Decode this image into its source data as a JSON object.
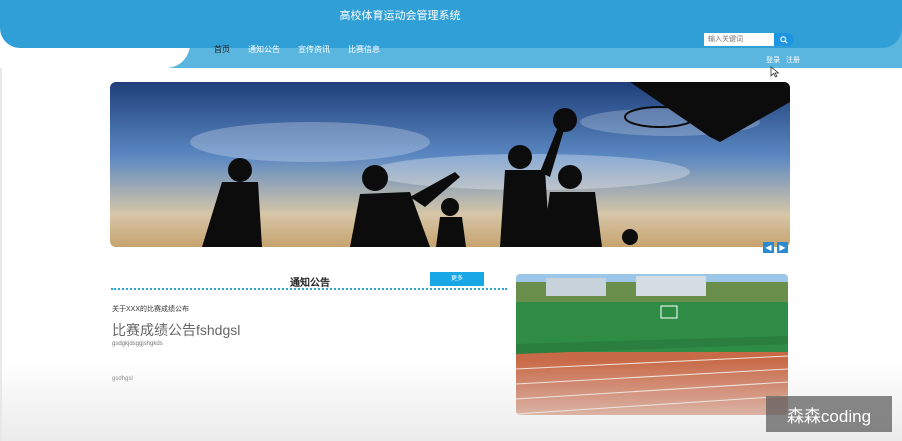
{
  "header": {
    "title": "高校体育运动会管理系统"
  },
  "nav": {
    "items": [
      "首页",
      "通知公告",
      "宣传资讯",
      "比赛信息"
    ]
  },
  "search": {
    "placeholder": "输入关键词"
  },
  "auth": {
    "login": "登录",
    "register": "注册"
  },
  "notice": {
    "title": "通知公告",
    "more": "更多",
    "item_title": "关于XXX的比赛成绩公布",
    "headline": "比赛成绩公告fshdgsl",
    "sub": "gsdgkjdsggjshgkds",
    "footer": "gsdhgsl"
  },
  "watermark": "森森coding",
  "colors": {
    "header": "#2f9fd6",
    "nav": "#5bb6df",
    "accent": "#19a7e6"
  },
  "icons": {
    "search": "search-icon",
    "prev": "arrow-left-icon",
    "next": "arrow-right-icon"
  }
}
